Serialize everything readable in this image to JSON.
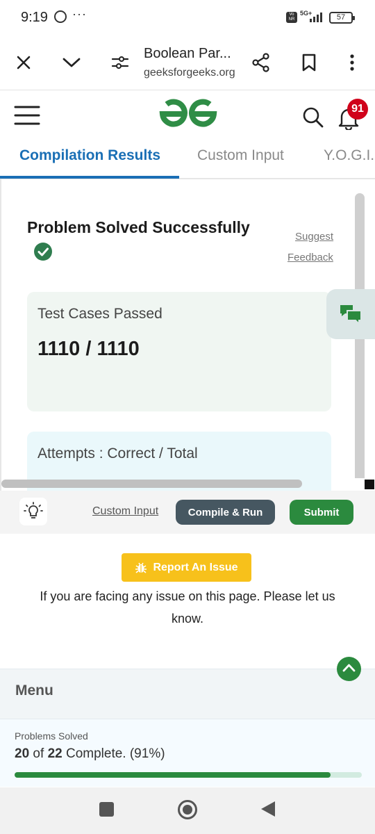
{
  "status_bar": {
    "time": "9:19",
    "overflow_dots": "···",
    "volte": "Vo NR",
    "network": "5G+",
    "battery": "57"
  },
  "browser": {
    "page_title": "Boolean Par...",
    "domain": "geeksforgeeks.org",
    "icons": [
      "close-icon",
      "chevron-down-icon",
      "site-settings-icon",
      "share-icon",
      "bookmark-icon",
      "more-vert-icon"
    ]
  },
  "site_header": {
    "notification_count": "91",
    "brand_color": "#2f8d46"
  },
  "tabs": [
    {
      "label": "Compilation Results",
      "active": true
    },
    {
      "label": "Custom Input",
      "active": false
    },
    {
      "label": "Y.O.G.I.",
      "active": false
    }
  ],
  "results": {
    "heading": "Problem Solved Successfully",
    "suggest": "Suggest",
    "feedback": "Feedback",
    "test_cases_label": "Test Cases Passed",
    "test_cases_value": "1110 / 1110",
    "attempts_label": "Attempts : Correct / Total"
  },
  "actions": {
    "custom_input": "Custom Input",
    "compile_run": "Compile & Run",
    "submit": "Submit"
  },
  "report": {
    "button": "Report An Issue",
    "message": "If you are facing any issue on this page. Please let us know."
  },
  "menu": {
    "label": "Menu",
    "problems_solved_label": "Problems Solved",
    "solved": "20",
    "of_word": "of",
    "total": "22",
    "complete_text": "Complete. (91%)",
    "progress_fraction": 0.91
  },
  "colors": {
    "accent_blue": "#1a6fb5",
    "green": "#2b8a3e",
    "dark_button": "#465761",
    "report_yellow": "#f7c11b",
    "badge_red": "#d0021b"
  }
}
